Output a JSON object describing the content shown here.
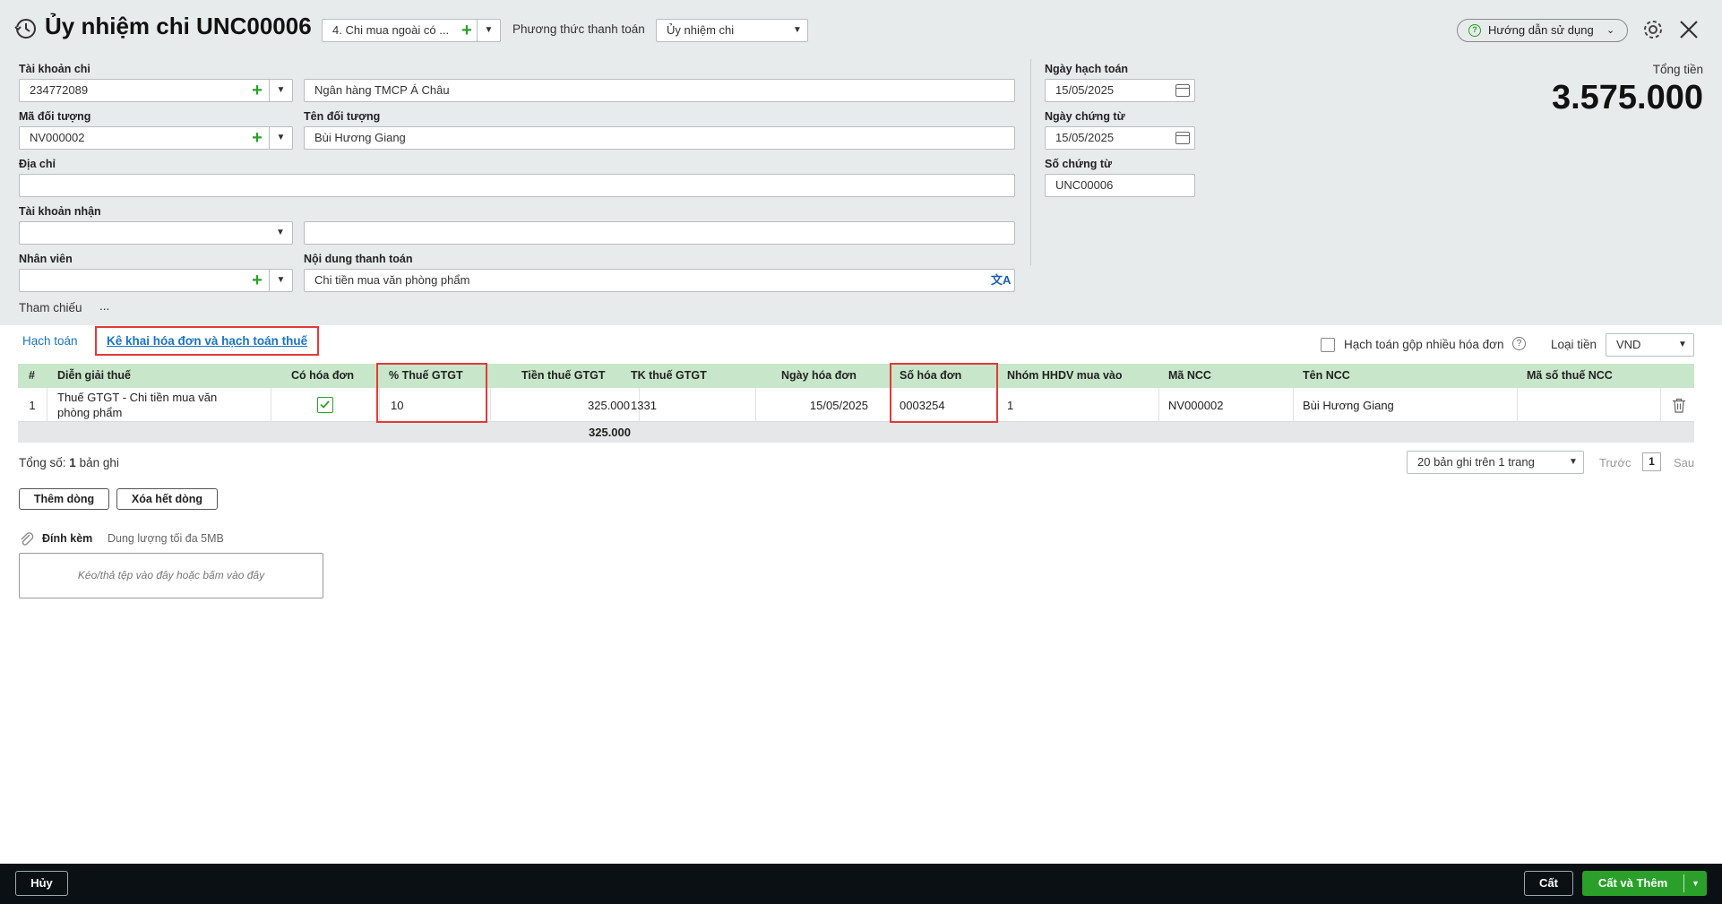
{
  "header": {
    "title": "Ủy nhiệm chi UNC00006",
    "transaction_type": "4. Chi mua ngoài có ...",
    "payment_method_label": "Phương thức thanh toán",
    "payment_method_value": "Ủy nhiệm chi",
    "help_label": "Hướng dẫn sử dụng"
  },
  "form": {
    "tai_khoan_chi_label": "Tài khoản chi",
    "tai_khoan_chi_value": "234772089",
    "bank_name_value": "Ngân hàng TMCP Á Châu",
    "ma_doi_tuong_label": "Mã đối tượng",
    "ma_doi_tuong_value": "NV000002",
    "ten_doi_tuong_label": "Tên đối tượng",
    "ten_doi_tuong_value": "Bùi Hương Giang",
    "dia_chi_label": "Địa chỉ",
    "dia_chi_value": "",
    "tai_khoan_nhan_label": "Tài khoản nhận",
    "tai_khoan_nhan_value": "",
    "nhan_vien_label": "Nhân viên",
    "nhan_vien_value": "",
    "noi_dung_label": "Nội dung thanh toán",
    "noi_dung_value": "Chi tiền mua văn phòng phẩm",
    "tham_chieu_label": "Tham chiếu",
    "tham_chieu_more": "...",
    "ngay_hach_toan_label": "Ngày hạch toán",
    "ngay_hach_toan_value": "15/05/2025",
    "ngay_chung_tu_label": "Ngày chứng từ",
    "ngay_chung_tu_value": "15/05/2025",
    "so_chung_tu_label": "Số chứng từ",
    "so_chung_tu_value": "UNC00006",
    "tong_tien_label": "Tổng tiền",
    "tong_tien_value": "3.575.000"
  },
  "tabs": {
    "hach_toan": "Hạch toán",
    "ke_khai": "Kê khai hóa đơn và hạch toán thuế"
  },
  "options": {
    "gop_label": "Hạch toán gộp nhiều hóa đơn",
    "loai_tien_label": "Loại tiền",
    "loai_tien_value": "VND"
  },
  "grid": {
    "columns": [
      "#",
      "Diễn giải thuế",
      "Có hóa đơn",
      "% Thuế GTGT",
      "Tiền thuế GTGT",
      "TK thuế GTGT",
      "Ngày hóa đơn",
      "Số hóa đơn",
      "Nhóm HHDV mua vào",
      "Mã NCC",
      "Tên NCC",
      "Mã số thuế NCC"
    ],
    "row": {
      "index": "1",
      "dien_giai_line1": "Thuế GTGT - Chi tiền mua văn",
      "dien_giai_line2": "phòng phẩm",
      "co_hoa_don": true,
      "thue_suat": "10",
      "tien_thue": "325.000",
      "tk_thue": "1331",
      "ngay_hoa_don": "15/05/2025",
      "so_hoa_don": "0003254",
      "nhom_hhdv": "1",
      "ma_ncc": "NV000002",
      "ten_ncc": "Bùi Hương Giang",
      "mst_ncc": ""
    },
    "total_tien_thue": "325.000"
  },
  "pagination": {
    "total_prefix": "Tổng số:",
    "total_count": "1",
    "total_suffix": "bản ghi",
    "page_size": "20 bản ghi trên 1 trang",
    "prev": "Trước",
    "page": "1",
    "next": "Sau"
  },
  "actions": {
    "them_dong": "Thêm dòng",
    "xoa_het_dong": "Xóa hết dòng"
  },
  "attach": {
    "label": "Đính kèm",
    "hint": "Dung lượng tối đa 5MB",
    "dropzone": "Kéo/thả tệp vào đây hoặc bấm vào đây"
  },
  "footer": {
    "huy": "Hủy",
    "cat": "Cất",
    "cat_va_them": "Cất và Thêm"
  },
  "colors": {
    "accent_green": "#2aa02a",
    "grid_header": "#c8e6c9",
    "highlight_red": "#e5393a",
    "link_blue": "#1a73c8",
    "footer_bg": "#0b1014"
  }
}
